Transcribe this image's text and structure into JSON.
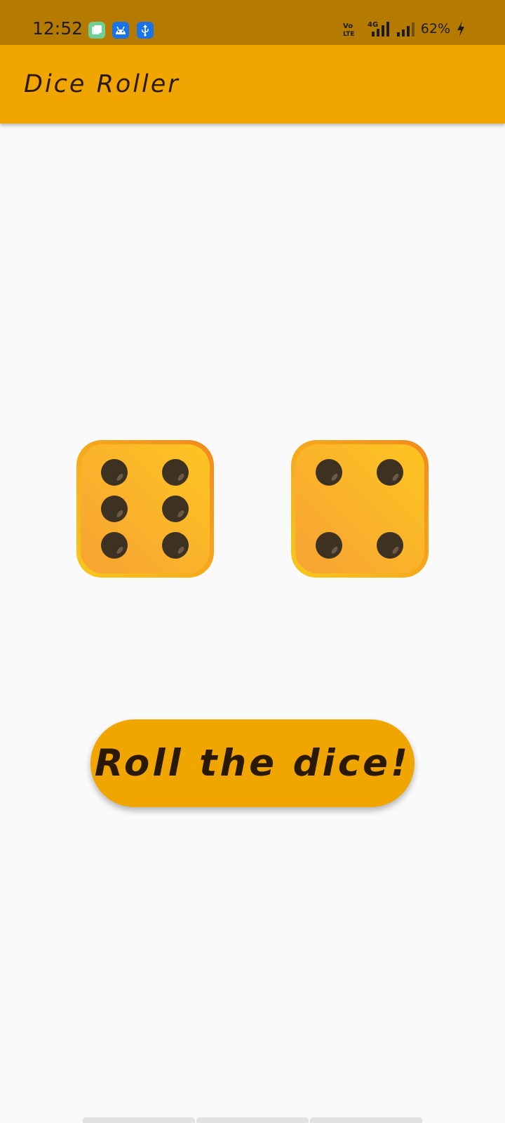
{
  "status_bar": {
    "time": "12:52",
    "network_label": "4G",
    "volte_label": "Vo LTE",
    "battery": "62%",
    "notification_icons": [
      "gallery-icon",
      "android-icon",
      "usb-icon"
    ],
    "colors": {
      "background": "#b57b00"
    }
  },
  "app_bar": {
    "title": "Dice Roller",
    "colors": {
      "background": "#f0a500"
    }
  },
  "dice": [
    {
      "name": "left-die",
      "value": 6
    },
    {
      "name": "right-die",
      "value": 4
    }
  ],
  "roll_button": {
    "label": "Roll the dice!",
    "colors": {
      "background": "#f0a500",
      "text": "#2a1a05"
    }
  },
  "colors": {
    "page_background": "#fafafa",
    "die_face": "#fbb829",
    "die_border": "#f5a21e",
    "pip": "#3d3222"
  }
}
